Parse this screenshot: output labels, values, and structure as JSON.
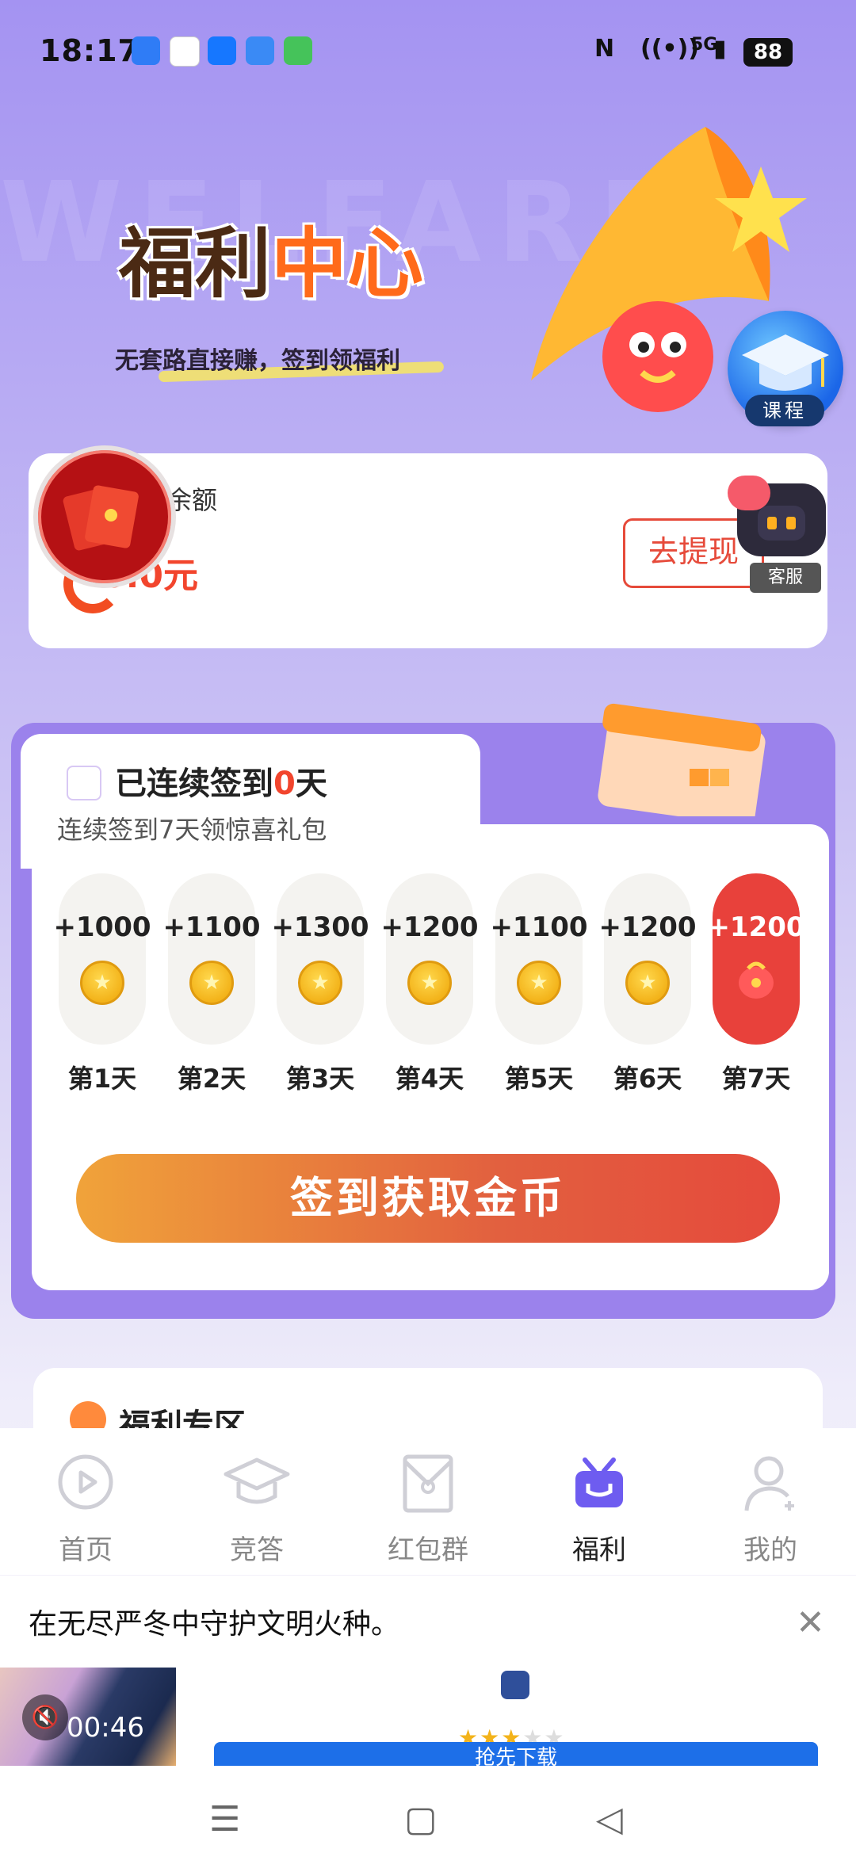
{
  "status_bar": {
    "time": "18:17",
    "network": "5G",
    "battery": "88"
  },
  "hero": {
    "watermark": "WELFARE",
    "title_part1": "福利",
    "title_part2": "中心",
    "subtitle": "无套路直接赚，签到领福利",
    "course_label": "课程"
  },
  "balance": {
    "label": "余额",
    "amount": "0.0元",
    "withdraw_label": "去提现",
    "service_label": "客服"
  },
  "signin": {
    "title_prefix": "已连续签到",
    "streak": "0",
    "title_suffix": "天",
    "subtitle": "连续签到7天领惊喜礼包",
    "days": [
      {
        "value": "+1000",
        "label": "第1天"
      },
      {
        "value": "+1100",
        "label": "第2天"
      },
      {
        "value": "+1300",
        "label": "第3天"
      },
      {
        "value": "+1200",
        "label": "第4天"
      },
      {
        "value": "+1100",
        "label": "第5天"
      },
      {
        "value": "+1200",
        "label": "第6天"
      },
      {
        "value": "+1200",
        "label": "第7天"
      }
    ],
    "button_label": "签到获取金币"
  },
  "welfare_zone": {
    "title": "福利专区"
  },
  "bottom_nav": {
    "items": [
      {
        "label": "首页"
      },
      {
        "label": "竞答"
      },
      {
        "label": "红包群"
      },
      {
        "label": "福利"
      },
      {
        "label": "我的"
      }
    ],
    "active_index": 3,
    "accent": "#6e5cf0"
  },
  "ad": {
    "text": "在无尽严冬中守护文明火种。",
    "timer": "00:46",
    "button_label": "抢先下载"
  },
  "colors": {
    "accent_red": "#e8413b",
    "accent_purple": "#9b82ec"
  }
}
